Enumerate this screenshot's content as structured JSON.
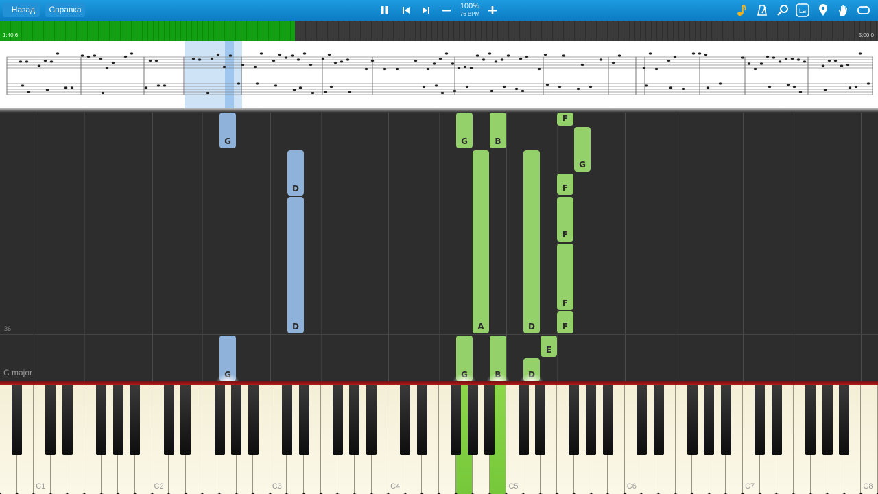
{
  "toolbar": {
    "back_label": "Назад",
    "help_label": "Справка",
    "speed_percent": "100%",
    "bpm": "76 BPM",
    "icons": [
      "pause-icon",
      "prev-icon",
      "next-icon",
      "minus-icon",
      "plus-icon",
      "note-icon",
      "metronome-icon",
      "search-icon",
      "finger-hints-icon",
      "marker-icon",
      "hand-icon",
      "loop-icon"
    ]
  },
  "progress": {
    "current_time": "1:40.6",
    "total_time": "5:00.0",
    "fraction": 0.336
  },
  "roll": {
    "measure_number": "36",
    "key_signature": "C major"
  },
  "notes": [
    {
      "label": "G",
      "hand": "left",
      "key": "G2",
      "top_frac": 0.0
    },
    {
      "label": "D",
      "hand": "left",
      "key": "D3"
    },
    {
      "label": "D",
      "hand": "left",
      "key": "D3"
    },
    {
      "label": "G",
      "hand": "left",
      "key": "G2"
    },
    {
      "label": "G",
      "hand": "right",
      "key": "G4"
    },
    {
      "label": "B",
      "hand": "right",
      "key": "B4"
    },
    {
      "label": "A",
      "hand": "right",
      "key": "A4"
    },
    {
      "label": "D",
      "hand": "right",
      "key": "D5"
    },
    {
      "label": "F",
      "hand": "right",
      "key": "F5"
    },
    {
      "label": "G",
      "hand": "right",
      "key": "G5"
    },
    {
      "label": "F",
      "hand": "right",
      "key": "F5"
    },
    {
      "label": "F",
      "hand": "right",
      "key": "F5"
    },
    {
      "label": "F",
      "hand": "right",
      "key": "F5"
    },
    {
      "label": "F",
      "hand": "right",
      "key": "F5"
    },
    {
      "label": "E",
      "hand": "right",
      "key": "E5"
    },
    {
      "label": "D",
      "hand": "right",
      "key": "D5"
    },
    {
      "label": "G",
      "hand": "right",
      "key": "G4"
    },
    {
      "label": "B",
      "hand": "right",
      "key": "B4"
    }
  ],
  "keyboard": {
    "octave_labels": [
      "C1",
      "C2",
      "C3",
      "C4",
      "C5",
      "C6",
      "C7",
      "C8"
    ],
    "pressed_keys": [
      "G4",
      "B4"
    ]
  },
  "colors": {
    "left_hand": "#8eb2d9",
    "right_hand": "#95d16a",
    "toolbar": "#1a90d8",
    "progress": "#12a012"
  }
}
